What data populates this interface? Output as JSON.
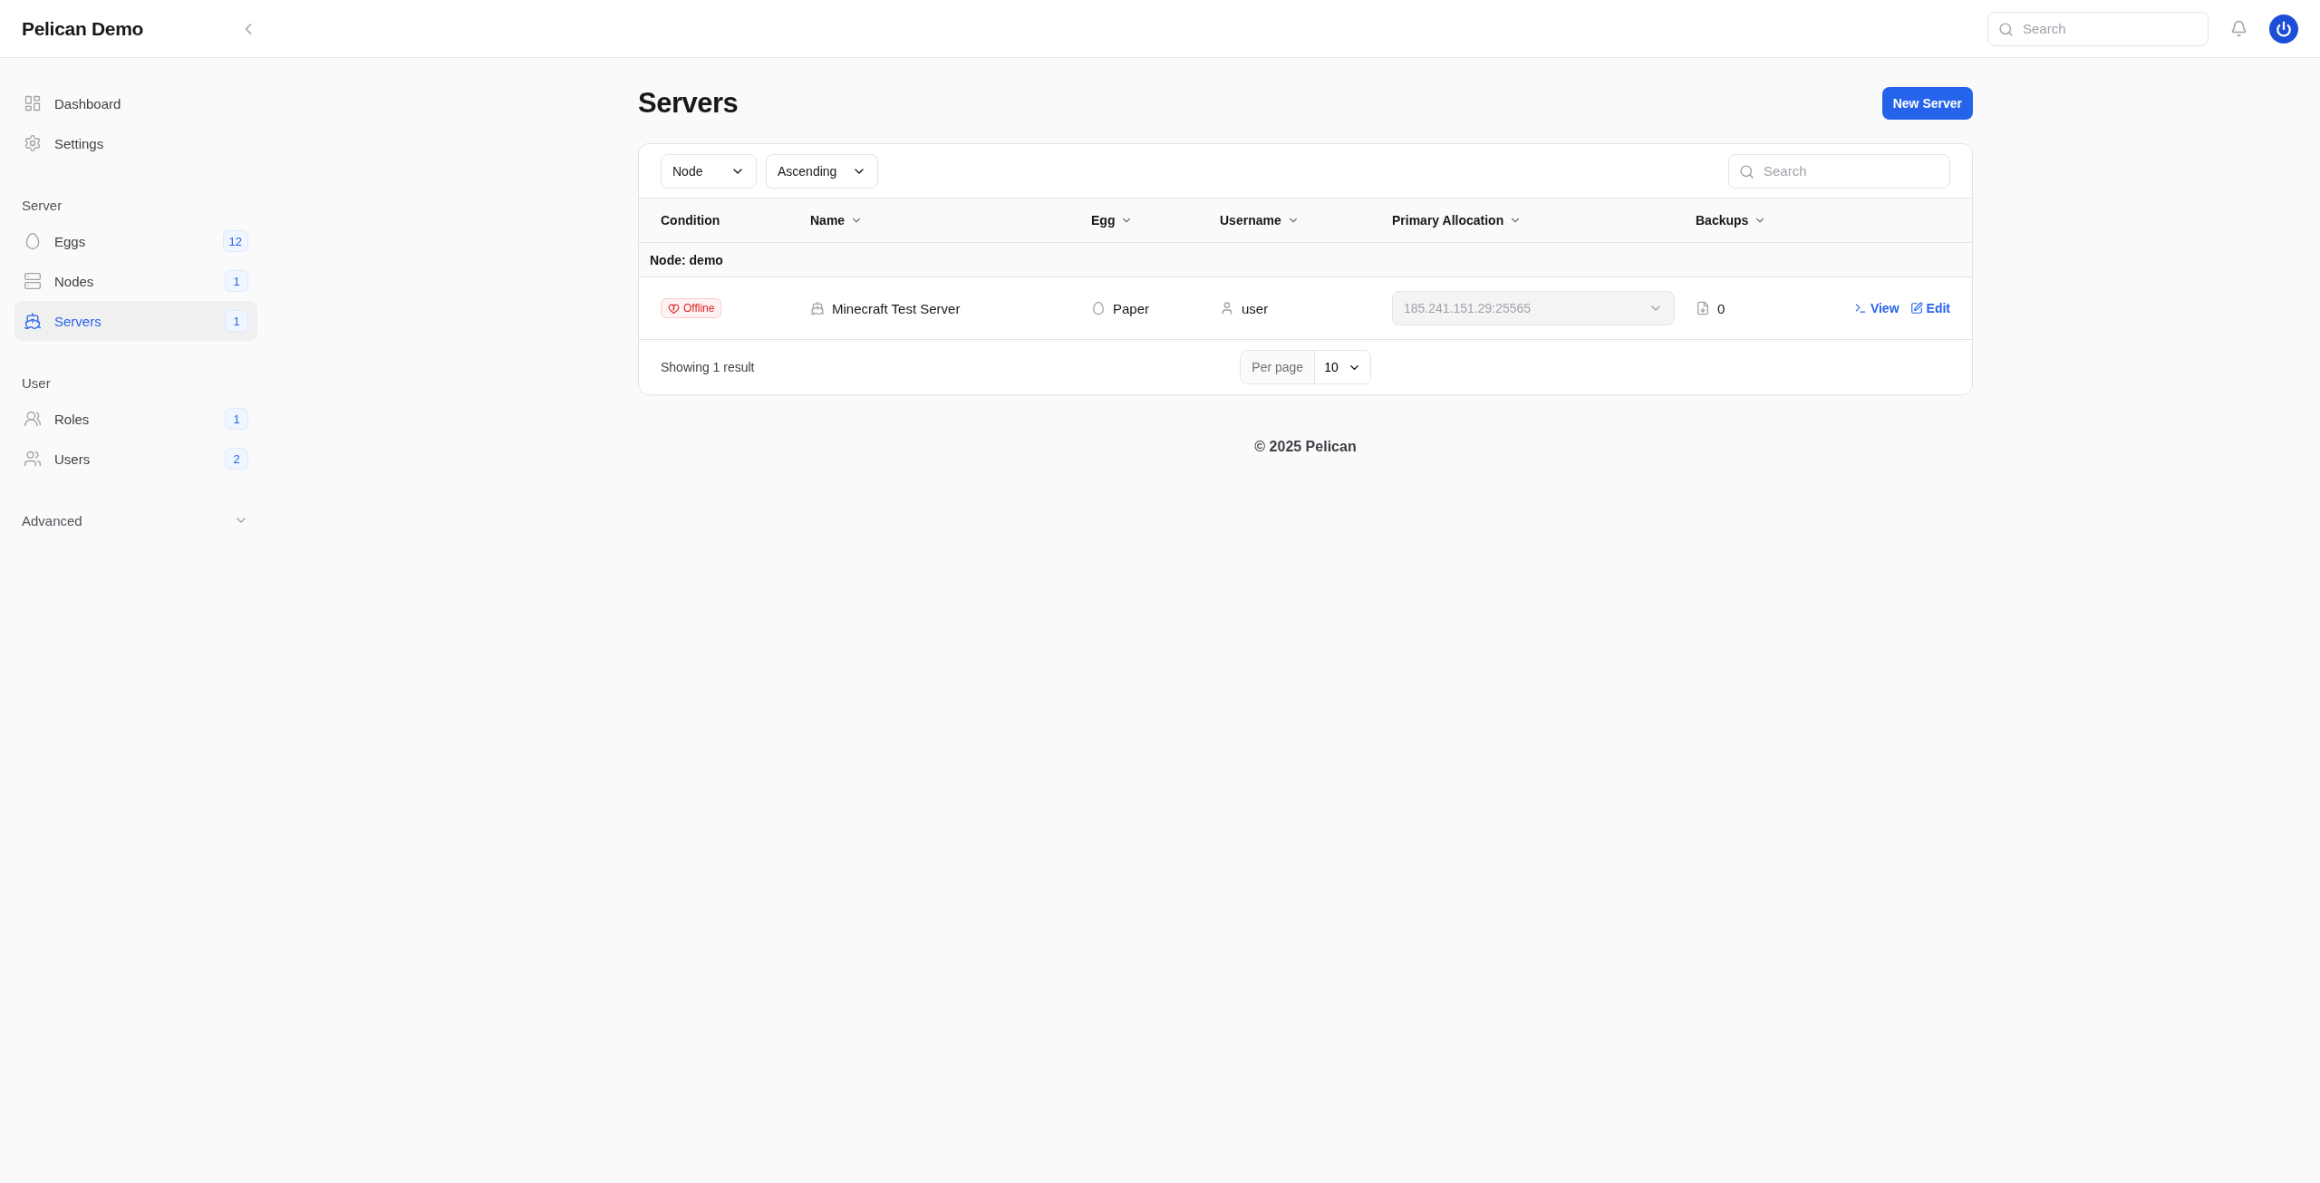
{
  "app": {
    "title": "Pelican Demo"
  },
  "header": {
    "search_placeholder": "Search"
  },
  "sidebar": {
    "groups": [
      {
        "items": [
          {
            "label": "Dashboard",
            "selected": false
          },
          {
            "label": "Settings",
            "selected": false
          }
        ]
      },
      {
        "label": "Server",
        "items": [
          {
            "label": "Eggs",
            "count": "12",
            "selected": false
          },
          {
            "label": "Nodes",
            "count": "1",
            "selected": false
          },
          {
            "label": "Servers",
            "count": "1",
            "selected": true
          }
        ]
      },
      {
        "label": "User",
        "items": [
          {
            "label": "Roles",
            "count": "1",
            "selected": false
          },
          {
            "label": "Users",
            "count": "2",
            "selected": false
          }
        ]
      }
    ],
    "collapsed_groups": [
      {
        "label": "Advanced",
        "expanded": false
      }
    ]
  },
  "page": {
    "title": "Servers",
    "primary_action": "New Server"
  },
  "table": {
    "filters": [
      {
        "value": "Node"
      },
      {
        "value": "Ascending"
      }
    ],
    "search_placeholder": "Search",
    "columns": [
      {
        "label": "Condition",
        "sortable": false
      },
      {
        "label": "Name",
        "sortable": true
      },
      {
        "label": "Egg",
        "sortable": true
      },
      {
        "label": "Username",
        "sortable": true
      },
      {
        "label": "Primary Allocation",
        "sortable": true
      },
      {
        "label": "Backups",
        "sortable": true
      }
    ],
    "groups": [
      {
        "label": "Node: demo",
        "rows": [
          {
            "status": "Offline",
            "name": "Minecraft Test Server",
            "egg": "Paper",
            "username": "user",
            "allocation": "185.241.151.29:25565",
            "backups": "0",
            "actions": [
              "View",
              "Edit"
            ]
          }
        ]
      }
    ],
    "footer": {
      "summary": "Showing 1 result",
      "per_page_label": "Per page",
      "per_page": "10"
    }
  },
  "footer": {
    "copyright": "© 2025 Pelican"
  }
}
